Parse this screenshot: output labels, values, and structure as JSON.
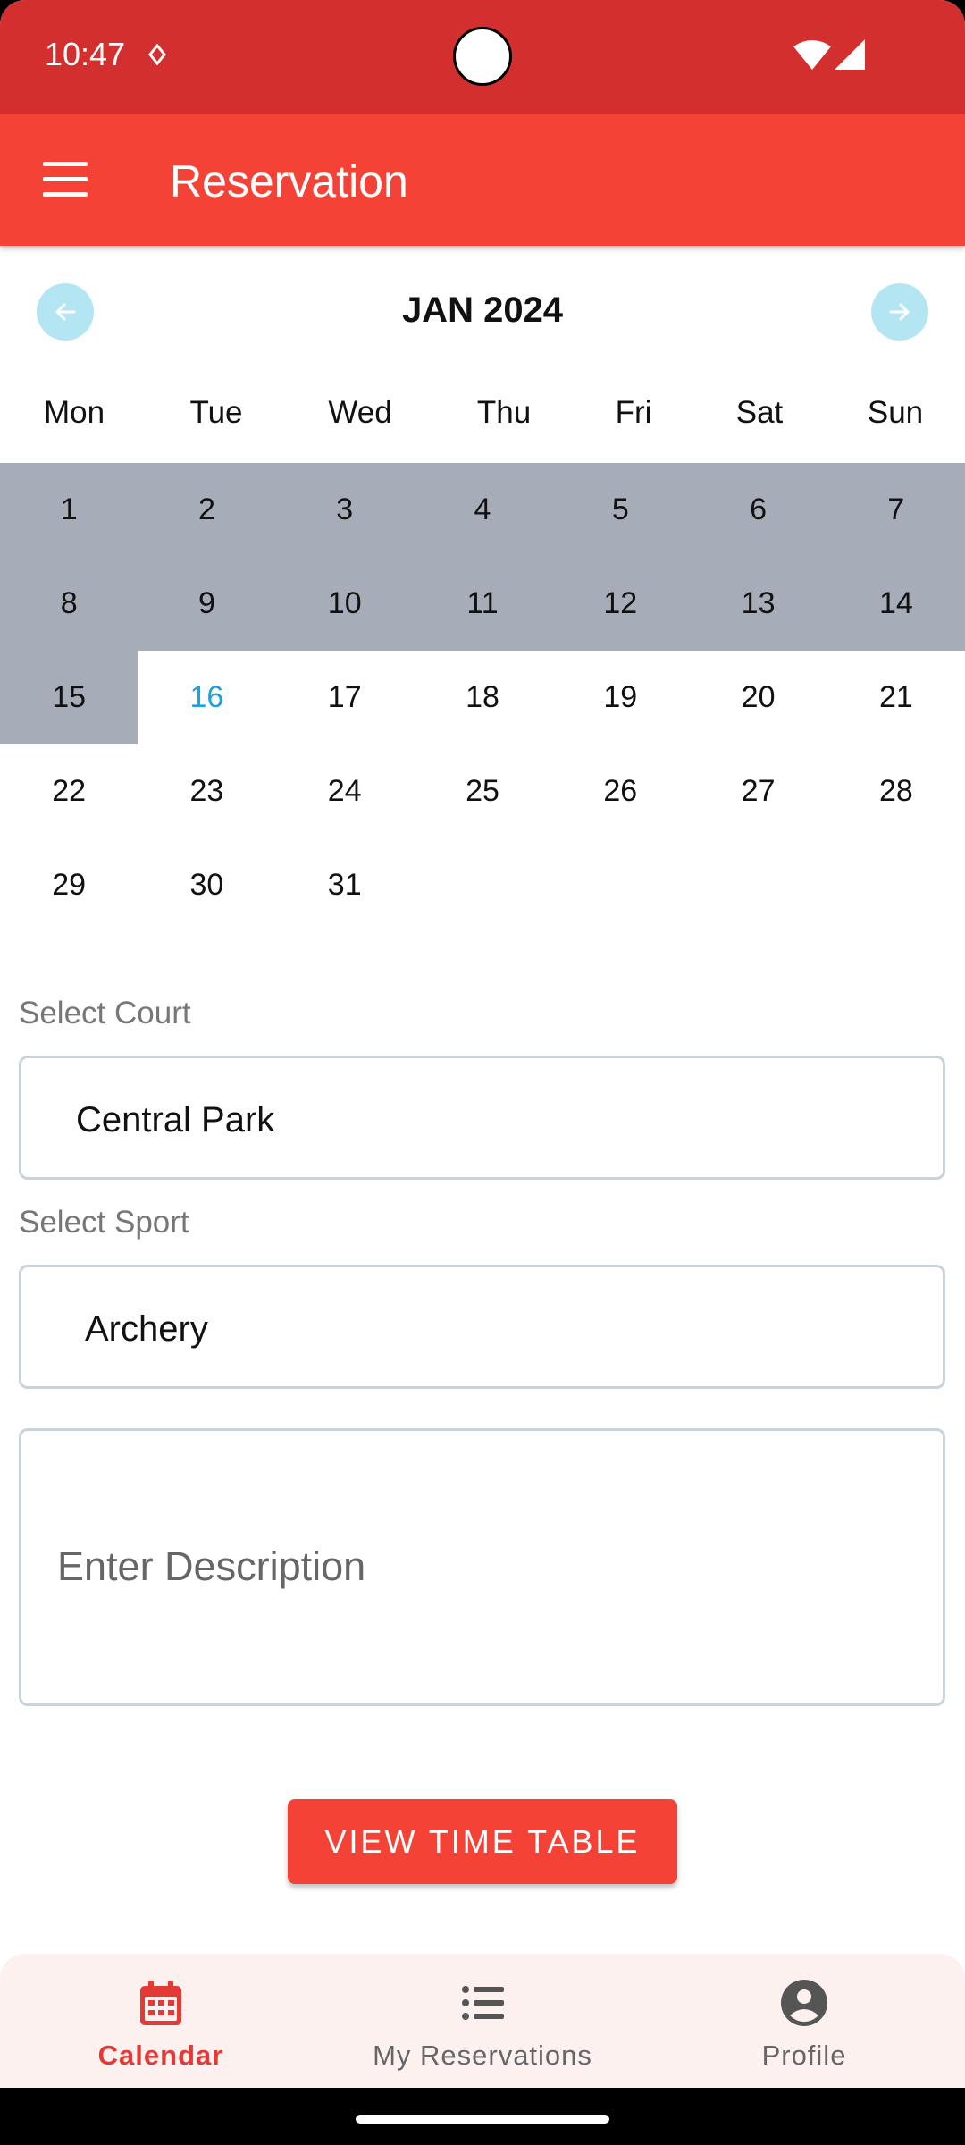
{
  "status_bar": {
    "time": "10:47"
  },
  "app_bar": {
    "title": "Reservation"
  },
  "calendar": {
    "month_label": "JAN 2024",
    "weekdays": [
      "Mon",
      "Tue",
      "Wed",
      "Thu",
      "Fri",
      "Sat",
      "Sun"
    ],
    "days": [
      "1",
      "2",
      "3",
      "4",
      "5",
      "6",
      "7",
      "8",
      "9",
      "10",
      "11",
      "12",
      "13",
      "14",
      "15",
      "16",
      "17",
      "18",
      "19",
      "20",
      "21",
      "22",
      "23",
      "24",
      "25",
      "26",
      "27",
      "28",
      "29",
      "30",
      "31"
    ],
    "today": "16",
    "past_days_through": "15"
  },
  "form": {
    "court_label": "Select Court",
    "court_value": "Central Park",
    "sport_label": "Select Sport",
    "sport_value": "Archery",
    "description_placeholder": "Enter Description",
    "submit_label": "VIEW TIME TABLE"
  },
  "bottom_nav": {
    "items": [
      {
        "label": "Calendar",
        "icon": "calendar-icon",
        "active": true
      },
      {
        "label": "My Reservations",
        "icon": "list-icon",
        "active": false
      },
      {
        "label": "Profile",
        "icon": "account-circle-icon",
        "active": false
      }
    ]
  },
  "colors": {
    "status_bar": "#d32f2f",
    "app_bar": "#f44336",
    "past_day_bg": "#a7adb8",
    "today_text": "#1ea0d8",
    "nav_arrow_bg": "#b3e5f3",
    "active_nav": "#e53935"
  }
}
